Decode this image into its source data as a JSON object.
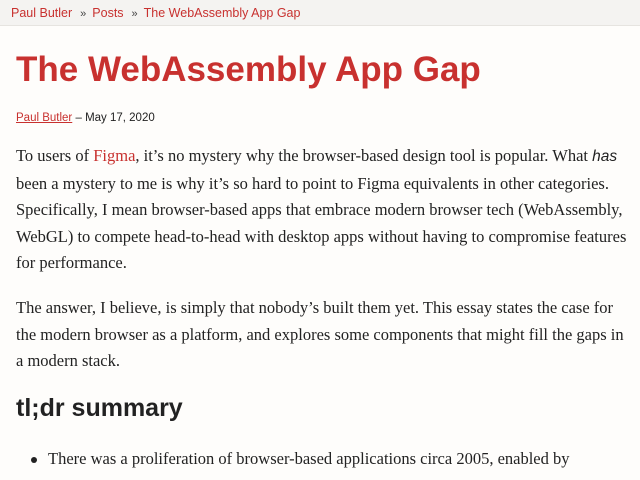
{
  "breadcrumb": {
    "items": [
      "Paul Butler",
      "Posts",
      "The WebAssembly App Gap"
    ],
    "separator": "»"
  },
  "post": {
    "title": "The WebAssembly App Gap",
    "author": "Paul Butler",
    "date_sep": " – ",
    "date": "May 17, 2020"
  },
  "p1": {
    "t1": "To users of ",
    "link": "Figma",
    "t2": ", it’s no mystery why the browser-based design tool is popular. What ",
    "em": "has",
    "t3": " been a mystery to me is why it’s so hard to point to Figma equivalents in other categories. Specifically, I mean browser-based apps that embrace modern browser tech (WebAssembly, WebGL) to compete head-to-head with desktop apps without having to compromise features for performance."
  },
  "p2": {
    "text": "The answer, I believe, is simply that nobody’s built them yet. This essay states the case for the modern browser as a platform, and explores some components that might fill the gaps in a modern stack."
  },
  "summary": {
    "heading": "tl;dr summary",
    "items": [
      "There was a proliferation of browser-based applications circa 2005, enabled by"
    ]
  },
  "colors": {
    "accent": "#c8312f",
    "text": "#222222",
    "background": "#fefdfb",
    "breadcrumb_bg": "#f4f3f1"
  }
}
